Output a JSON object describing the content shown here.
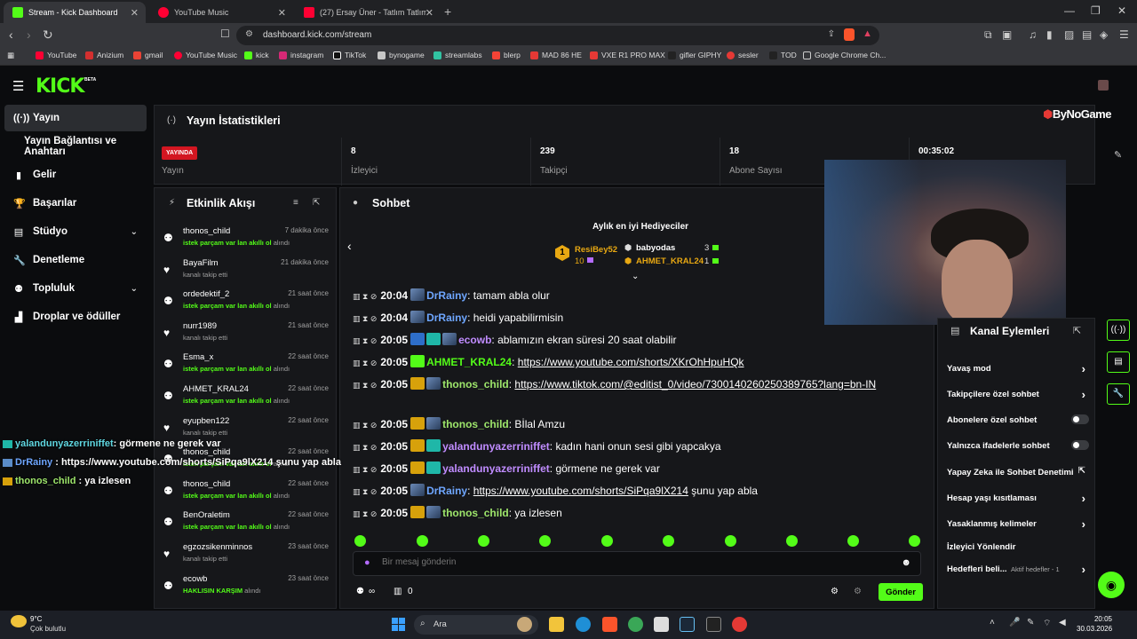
{
  "browser": {
    "tabs": [
      {
        "label": "Stream - Kick Dashboard",
        "active": true
      },
      {
        "label": "YouTube Music"
      },
      {
        "label": "(27) Ersay Üner - Tatlım Tatlım | Klip -"
      }
    ],
    "url": "dashboard.kick.com/stream",
    "bookmarks": [
      "YouTube",
      "Anizium",
      "gmail",
      "YouTube Music",
      "kick",
      "instagram",
      "TikTok",
      "bynogame",
      "streamlabs",
      "blerp",
      "MAD 86 HE",
      "VXE R1 PRO MAX",
      "gifler GIPHY",
      "sesler",
      "TOD",
      "Google Chrome Ch..."
    ]
  },
  "kick": {
    "logo": "KICK",
    "beta": "BETA"
  },
  "sidebar": {
    "items": [
      {
        "label": "Yayın",
        "icon": "live-icon"
      },
      {
        "label": "Yayın Bağlantısı ve Anahtarı",
        "icon": ""
      },
      {
        "label": "Gelir",
        "icon": "revenue-icon"
      },
      {
        "label": "Başarılar",
        "icon": "trophy-icon"
      },
      {
        "label": "Stüdyo",
        "icon": "studio-icon"
      },
      {
        "label": "Denetleme",
        "icon": "wrench-icon"
      },
      {
        "label": "Topluluk",
        "icon": "community-icon"
      },
      {
        "label": "Droplar ve ödüller",
        "icon": "drops-icon"
      }
    ]
  },
  "stats": {
    "title": "Yayın İstatistikleri",
    "live_badge": "YAYINDA",
    "live_label": "Yayın",
    "viewers_value": "8",
    "viewers_label": "İzleyici",
    "followers_value": "239",
    "followers_label": "Takipçi",
    "subs_value": "18",
    "subs_label": "Abone Sayısı",
    "uptime_value": "00:35:02",
    "sponsor": "ByNoGame"
  },
  "activity": {
    "title": "Etkinlik Akışı",
    "rows": [
      {
        "name": "thonos_child",
        "time": "7 dakika önce",
        "sub_green": "istek parçam var lan akıllı ol",
        "sub_tail": " alındı",
        "icon": "reward"
      },
      {
        "name": "BayaFilm",
        "time": "21 dakika önce",
        "sub_green": "",
        "sub_tail": "kanalı takip etti",
        "icon": "heart"
      },
      {
        "name": "ordedektif_2",
        "time": "21 saat önce",
        "sub_green": "istek parçam var lan akıllı ol",
        "sub_tail": " alındı",
        "icon": "reward"
      },
      {
        "name": "nurr1989",
        "time": "21 saat önce",
        "sub_green": "",
        "sub_tail": "kanalı takip etti",
        "icon": "heart"
      },
      {
        "name": "Esma_x",
        "time": "22 saat önce",
        "sub_green": "istek parçam var lan akıllı ol",
        "sub_tail": " alındı",
        "icon": "reward"
      },
      {
        "name": "AHMET_KRAL24",
        "time": "22 saat önce",
        "sub_green": "istek parçam var lan akıllı ol",
        "sub_tail": " alındı",
        "icon": "reward"
      },
      {
        "name": "eyupben122",
        "time": "22 saat önce",
        "sub_green": "",
        "sub_tail": "kanalı takip etti",
        "icon": "heart"
      },
      {
        "name": "thonos_child",
        "time": "22 saat önce",
        "sub_green": "istek parçam var lan akıllı ol",
        "sub_tail": " alındı",
        "icon": "reward"
      },
      {
        "name": "thonos_child",
        "time": "22 saat önce",
        "sub_green": "istek parçam var lan akıllı ol",
        "sub_tail": " alındı",
        "icon": "reward"
      },
      {
        "name": "BenOraletim",
        "time": "22 saat önce",
        "sub_green": "istek parçam var lan akıllı ol",
        "sub_tail": " alındı",
        "icon": "reward"
      },
      {
        "name": "egzozsikenminnos",
        "time": "23 saat önce",
        "sub_green": "",
        "sub_tail": "kanalı takip etti",
        "icon": "heart"
      },
      {
        "name": "ecowb",
        "time": "23 saat önce",
        "sub_green": "HAKLISIN KARŞIM",
        "sub_tail": " alındı",
        "icon": "reward"
      }
    ]
  },
  "overlay": [
    {
      "user": "yalandunyazerriniffet",
      "text": ": görmene ne gerek var",
      "color": "#5fd6e0"
    },
    {
      "user": "DrRainy",
      "text": " : https://www.youtube.com/shorts/SiPqa9lX214 şunu yap abla",
      "color": "#6ea6ff"
    },
    {
      "user": "thonos_child",
      "text": " : ya izlesen",
      "color": "#9ee66b"
    }
  ],
  "chat": {
    "title": "Sohbet",
    "gifters_title": "Aylık en iyi Hediyeciler",
    "gifters": [
      {
        "rank": "1",
        "name": "ResiBey52",
        "count": "10"
      },
      {
        "name": "babyodas",
        "count": "3"
      },
      {
        "name": "AHMET_KRAL24",
        "count": "1"
      }
    ],
    "messages": [
      {
        "time": "20:04",
        "user": "DrRainy",
        "color": "#6ea6ff",
        "badges": [
          "avatar"
        ],
        "text": ": tamam abla olur",
        "link": ""
      },
      {
        "time": "20:04",
        "user": "DrRainy",
        "color": "#6ea6ff",
        "badges": [
          "avatar"
        ],
        "text": ": heidi yapabilirmisin",
        "link": ""
      },
      {
        "time": "20:05",
        "user": "ecowb",
        "color": "#c08cff",
        "badges": [
          "tool",
          "teal",
          "avatar"
        ],
        "text": ": ablamızın ekran süresi 20 saat olabilir",
        "link": ""
      },
      {
        "time": "20:05",
        "user": "AHMET_KRAL24",
        "color": "#53fc18",
        "badges": [
          "green"
        ],
        "text": ": ",
        "link": "https://www.youtube.com/shorts/XKrOhHpuHQk"
      },
      {
        "time": "20:05",
        "user": "thonos_child",
        "color": "#9ee66b",
        "badges": [
          "crown",
          "avatar"
        ],
        "text": ": ",
        "link": "https://www.tiktok.com/@editist_0/video/7300140260250389765?lang=bn-IN"
      },
      {
        "time": "20:05",
        "user": "thonos_child",
        "color": "#9ee66b",
        "badges": [
          "crown",
          "avatar"
        ],
        "text": ": Bİlal Amzu",
        "link": ""
      },
      {
        "time": "20:05",
        "user": "yalandunyazerriniffet",
        "color": "#c08cff",
        "badges": [
          "crown",
          "teal"
        ],
        "text": ": kadın hani onun sesi gibi yapcakya",
        "link": ""
      },
      {
        "time": "20:05",
        "user": "yalandunyazerriniffet",
        "color": "#c08cff",
        "badges": [
          "crown",
          "teal"
        ],
        "text": ": görmene ne gerek var",
        "link": ""
      },
      {
        "time": "20:05",
        "user": "DrRainy",
        "color": "#6ea6ff",
        "badges": [
          "avatar"
        ],
        "text": ": ",
        "link": "https://www.youtube.com/shorts/SiPqa9lX214",
        "tail": " şunu yap abla"
      },
      {
        "time": "20:05",
        "user": "thonos_child",
        "color": "#9ee66b",
        "badges": [
          "crown",
          "avatar"
        ],
        "text": ": ya izlesen",
        "link": ""
      }
    ],
    "input_placeholder": "Bir mesaj gönderin",
    "send_label": "Gönder",
    "points_label": "∞",
    "count_label": "0"
  },
  "actions": {
    "title": "Kanal Eylemleri",
    "items": [
      {
        "label": "Yavaş mod",
        "kind": "chev"
      },
      {
        "label": "Takipçilere özel sohbet",
        "kind": "chev"
      },
      {
        "label": "Abonelere özel sohbet",
        "kind": "toggle"
      },
      {
        "label": "Yalnızca ifadelerle sohbet",
        "kind": "toggle"
      },
      {
        "label": "Yapay Zeka ile Sohbet Denetimi",
        "kind": "ext"
      },
      {
        "label": "Hesap yaşı kısıtlaması",
        "kind": "chev"
      },
      {
        "label": "Yasaklanmış kelimeler",
        "kind": "chev"
      },
      {
        "label": "İzleyici Yönlendir",
        "kind": "none"
      },
      {
        "label": "Hedefleri beli...",
        "kind": "chev",
        "extra": "Aktif hedefler - 1"
      }
    ]
  },
  "taskbar": {
    "temp": "9°C",
    "weather": "Çok bulutlu",
    "search": "Ara",
    "time": "20:05",
    "date": "30.03.2026"
  },
  "colors": {
    "accent": "#53fc18",
    "live": "#d31621",
    "panel": "#16171a",
    "bg": "#0b0c0e"
  }
}
